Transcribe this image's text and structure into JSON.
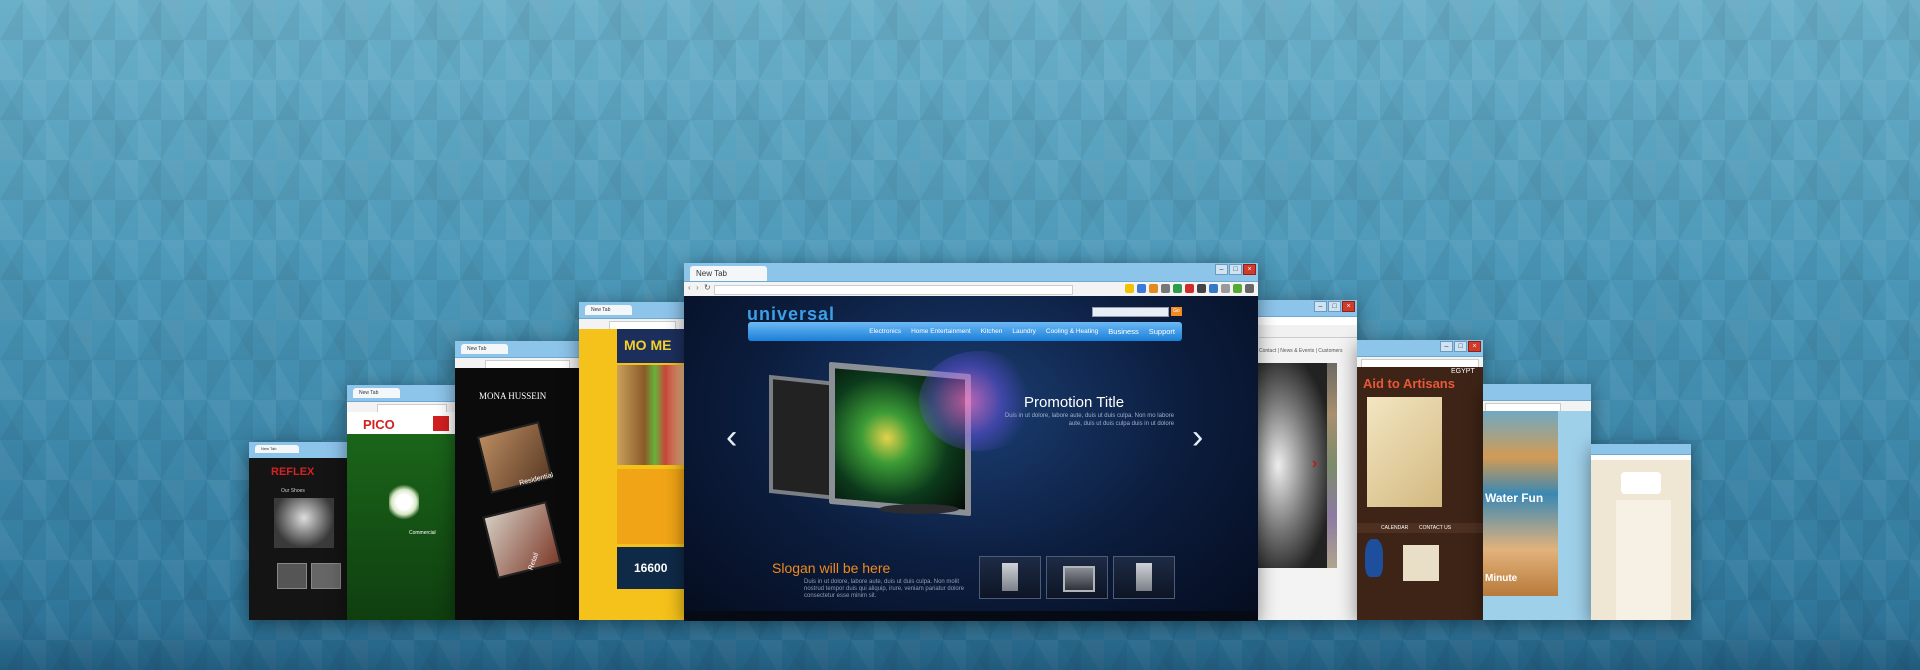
{
  "main_window": {
    "tab_title": "New Tab",
    "site": {
      "logo": "universal",
      "search_button": "Go",
      "menu": [
        "Electronics",
        "Home Entertainment",
        "Kitchen",
        "Laundry",
        "Cooling & Heating",
        "Business",
        "Support"
      ],
      "promo_title": "Promotion Title",
      "promo_text": "Duis in ut dolore, labore aute, duis ut duis culpa. Non mo labore aute, duis ut duis culpa duis in ut dolore",
      "slogan": "Slogan  will  be  here",
      "slogan_text": "Duis in ut dolore, labore aute, duis ut duis culpa. Non molit nostrud tempor duis qui aliquip, irure, veniam pariatur dolore consectetur esse minim sit."
    },
    "colors": {
      "accent": "#1a7fd8",
      "slogan": "#f08a1e"
    }
  },
  "windows": {
    "w1": {
      "tab_title": "New Tab",
      "logo": "REFLEX",
      "caption": "Our Shoes"
    },
    "w2": {
      "tab_title": "New Tab",
      "logo": "PICO",
      "caption": "Commercial"
    },
    "w3": {
      "tab_title": "New Tab",
      "logo": "MONA HUSSEIN",
      "labels": [
        "Residential",
        "Retail"
      ]
    },
    "w4": {
      "tab_title": "New Tab",
      "logo": "MO ME",
      "number": "16600"
    },
    "w6": {
      "tab_title": "",
      "nav_text": "Contact | News & Events | Customers"
    },
    "w7": {
      "tab_title": "",
      "title": "Aid to Artisans",
      "region": "EGYPT",
      "menu": [
        "CALENDAR",
        "CONTACT US"
      ]
    },
    "w8": {
      "tab_title": "",
      "headline": "Water Fun",
      "sub": "Minute"
    },
    "w9": {
      "tab_title": ""
    }
  }
}
